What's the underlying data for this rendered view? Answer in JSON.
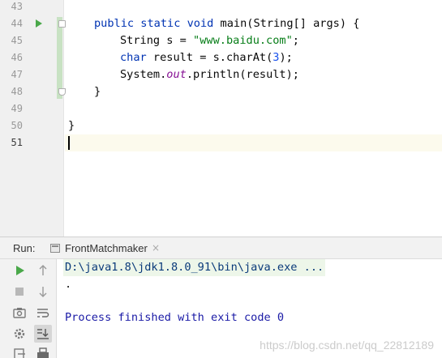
{
  "editor": {
    "line_numbers": [
      "43",
      "44",
      "45",
      "46",
      "47",
      "48",
      "49",
      "50",
      "51"
    ],
    "current_line": "51",
    "run_gutter_icon": "run-arrow-icon",
    "code": {
      "l44_kw1": "public",
      "l44_kw2": "static",
      "l44_kw3": "void",
      "l44_rest": " main(String[] args) {",
      "l45_a": "String s = ",
      "l45_str": "\"www.baidu.com\"",
      "l45_b": ";",
      "l46_kw": "char",
      "l46_a": " result = s.charAt(",
      "l46_num": "3",
      "l46_b": ");",
      "l47_a": "System.",
      "l47_fld": "out",
      "l47_b": ".println(result);",
      "l48": "}",
      "l50": "}"
    }
  },
  "run_panel": {
    "title": "Run:",
    "tab_label": "FrontMatchmaker",
    "tab_close": "×",
    "toolbar_icons": [
      "rerun-icon",
      "stop-icon",
      "camera-icon",
      "settings-icon",
      "exit-icon",
      "scroll-up-icon",
      "scroll-down-icon",
      "soft-wrap-icon",
      "scroll-to-end-icon",
      "print-icon"
    ],
    "console": {
      "command": "D:\\java1.8\\jdk1.8.0_91\\bin\\java.exe ...",
      "output": ".",
      "exit": "Process finished with exit code 0"
    }
  },
  "watermark": "https://blog.csdn.net/qq_22812189",
  "colors": {
    "keyword": "#0033b3",
    "string": "#067d17",
    "number": "#1750eb",
    "field": "#871094",
    "run_green": "#4aa84a",
    "current_line_bg": "#fcfaed"
  }
}
